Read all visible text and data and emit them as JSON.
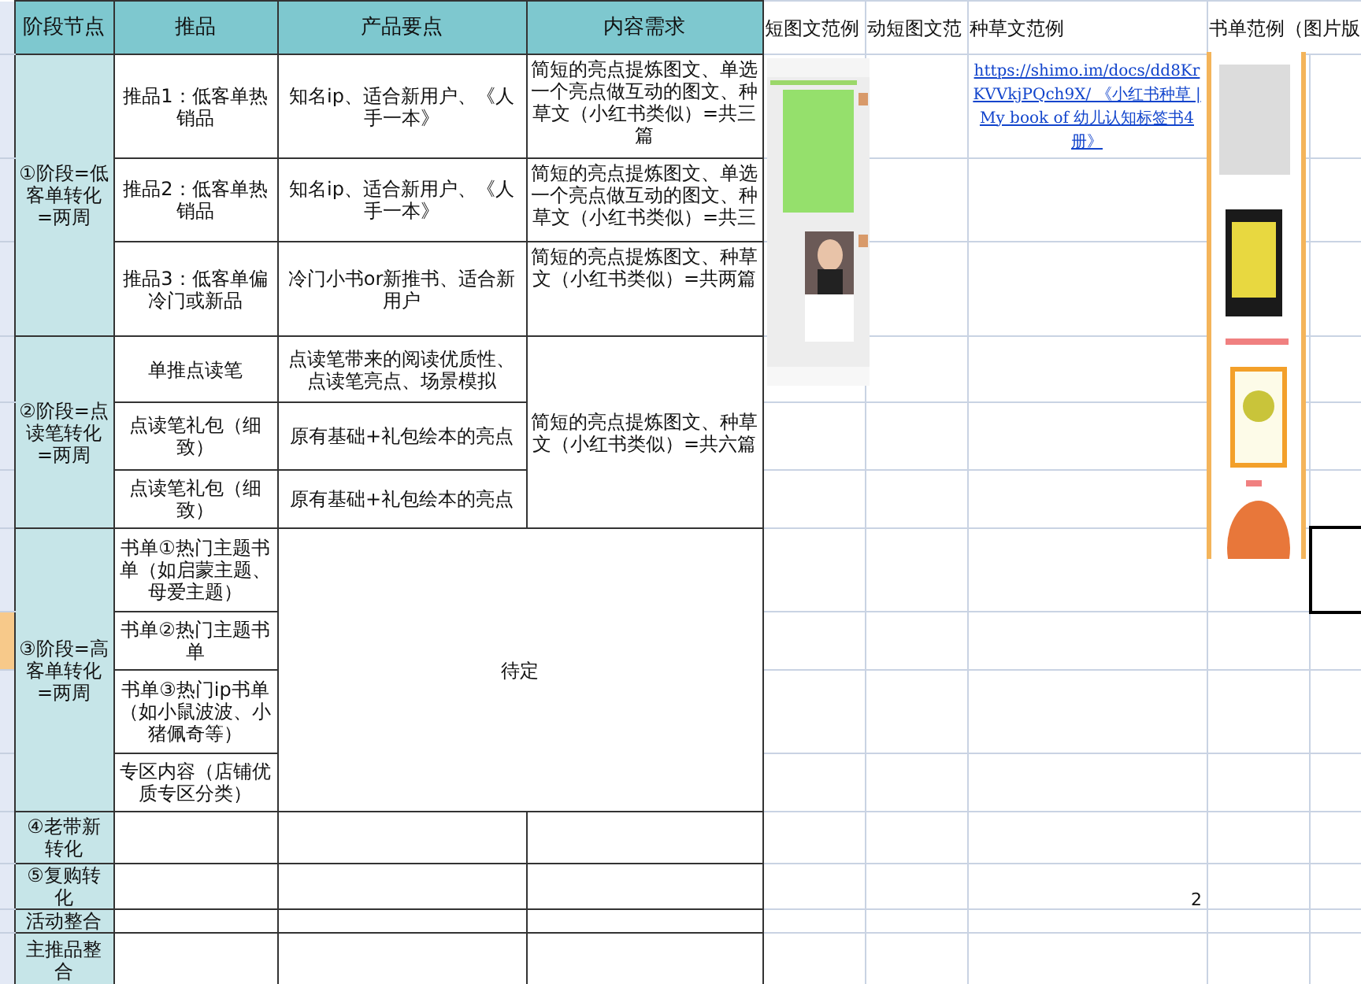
{
  "columns": [
    {
      "label": "阶段节点"
    },
    {
      "label": "推品"
    },
    {
      "label": "产品要点"
    },
    {
      "label": "内容需求"
    },
    {
      "label": "短图文范例"
    },
    {
      "label": "动短图文范"
    },
    {
      "label": "种草文范例"
    },
    {
      "label": "书单范例（图片版"
    }
  ],
  "stages": [
    {
      "label": "①阶段=低客单转化=两周",
      "rows": [
        {
          "product": "推品1：低客单热销品",
          "points": "知名ip、适合新用户、《人手一本》",
          "content": "简短的亮点提炼图文、单选一个亮点做互动的图文、种草文（小红书类似）=共三篇"
        },
        {
          "product": "推品2：低客单热销品",
          "points": "知名ip、适合新用户、《人手一本》",
          "content": "简短的亮点提炼图文、单选一个亮点做互动的图文、种草文（小红书类似）=共三"
        },
        {
          "product": "推品3：低客单偏冷门或新品",
          "points": "冷门小书or新推书、适合新用户",
          "content": "简短的亮点提炼图文、种草文（小红书类似）=共两篇"
        }
      ]
    },
    {
      "label": "②阶段=点读笔转化=两周",
      "content": "简短的亮点提炼图文、种草文（小红书类似）=共六篇",
      "rows": [
        {
          "product": "单推点读笔",
          "points": "点读笔带来的阅读优质性、点读笔亮点、场景模拟"
        },
        {
          "product": "点读笔礼包（细致）",
          "points": "原有基础+礼包绘本的亮点"
        },
        {
          "product": "点读笔礼包（细致）",
          "points": "原有基础+礼包绘本的亮点"
        }
      ]
    },
    {
      "label": "③阶段=高客单转化=两周",
      "note": "待定",
      "rows": [
        {
          "product": "书单①热门主题书单（如启蒙主题、母爱主题）"
        },
        {
          "product": "书单②热门主题书单"
        },
        {
          "product": "书单③热门ip书单（如小鼠波波、小猪佩奇等）"
        },
        {
          "product": "专区内容（店铺优质专区分类）"
        }
      ]
    },
    {
      "label": "④老带新转化"
    },
    {
      "label": "⑤复购转化"
    },
    {
      "label": "活动整合"
    },
    {
      "label": "主推品整合"
    }
  ],
  "seeding_example_link": "https://shimo.im/docs/dd8KrKVVkjPQch9X/ 《小红书种草 | My book of 幼儿认知标签书4册》",
  "page_number": "2"
}
